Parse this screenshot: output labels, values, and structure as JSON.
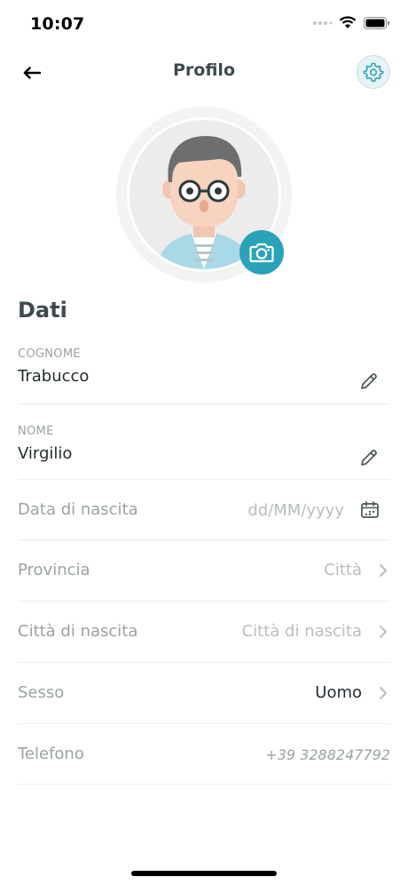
{
  "status": {
    "time": "10:07"
  },
  "nav": {
    "title": "Profilo"
  },
  "section": {
    "title": "Dati"
  },
  "fields": {
    "cognome": {
      "caption": "COGNOME",
      "value": "Trabucco"
    },
    "nome": {
      "caption": "NOME",
      "value": "Virgilio"
    }
  },
  "rows": {
    "data_nascita": {
      "label": "Data di nascita",
      "placeholder": "dd/MM/yyyy"
    },
    "provincia": {
      "label": "Provincia",
      "placeholder": "Città"
    },
    "citta_nascita": {
      "label": "Città di nascita",
      "placeholder": "Città di nascita"
    },
    "sesso": {
      "label": "Sesso",
      "value": "Uomo"
    },
    "telefono": {
      "label": "Telefono",
      "value": "+39 3288247792"
    }
  },
  "colors": {
    "accent": "#2aa3b8",
    "title_text": "#3d4a4e",
    "muted_text": "#9aa2a5"
  },
  "icons": [
    "back-arrow-icon",
    "gear-icon",
    "camera-icon",
    "pencil-icon",
    "calendar-icon",
    "chevron-right-icon",
    "wifi-icon",
    "battery-icon",
    "signal-icon"
  ]
}
